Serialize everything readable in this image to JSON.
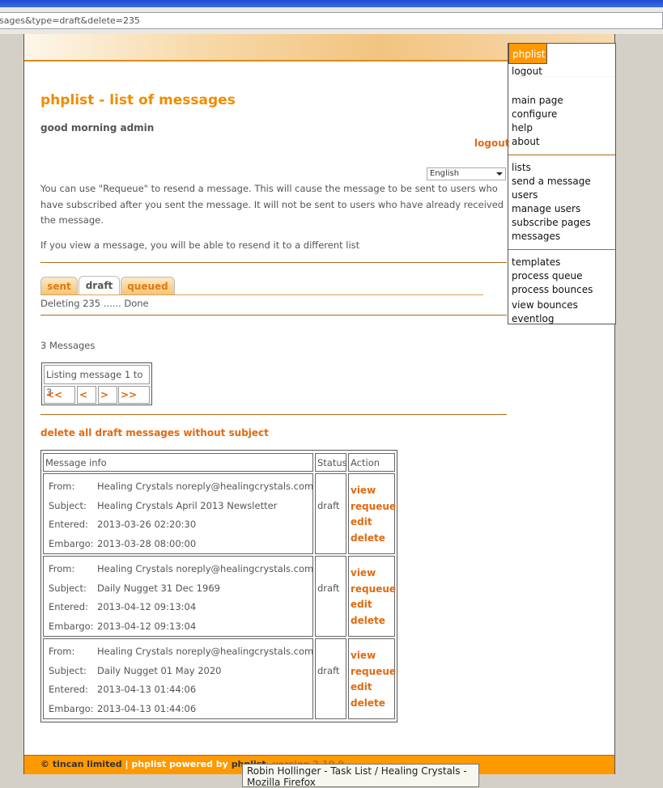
{
  "browser": {
    "url": "sages&type=draft&delete=235"
  },
  "menu": {
    "brand": "phplist",
    "logout": "logout",
    "group1": [
      "main page",
      "configure",
      "help",
      "about"
    ],
    "group2": [
      "lists",
      "send a message",
      "users",
      "manage users",
      "subscribe pages",
      "messages"
    ],
    "group3": [
      "templates",
      "process queue",
      "process bounces",
      "view bounces",
      "eventlog"
    ]
  },
  "page": {
    "title": "phplist - list of messages",
    "greeting": "good morning admin",
    "logout": "logout",
    "language": "English",
    "info1": "You can use \"Requeue\" to resend a message. This will cause the message to be sent to users who have subscribed after you sent the message. It will not be sent to users who have already received the message.",
    "info2": "If you view a message, you will be able to resend it to a different list",
    "tabs": [
      "sent",
      "draft",
      "queued"
    ],
    "status": "Deleting 235 ...... Done",
    "count": "3 Messages",
    "pager": {
      "caption": "Listing message 1 to 3",
      "first": "<<",
      "prev": "<",
      "next": ">",
      "last": ">>"
    },
    "delete_all": "delete all draft messages without subject"
  },
  "table": {
    "headers": [
      "Message info",
      "Status",
      "Action"
    ],
    "labels": [
      "From:",
      "Subject:",
      "Entered:",
      "Embargo:"
    ],
    "actions": [
      "view",
      "requeue",
      "edit",
      "delete"
    ],
    "rows": [
      {
        "from": "Healing Crystals noreply@healingcrystals.com",
        "subject": "Healing Crystals April 2013 Newsletter",
        "entered": "2013-03-26 02:20:30",
        "embargo": "2013-03-28 08:00:00",
        "status": "draft"
      },
      {
        "from": "Healing Crystals noreply@healingcrystals.com",
        "subject": "Daily Nugget 31 Dec 1969",
        "entered": "2013-04-12 09:13:04",
        "embargo": "2013-04-12 09:13:04",
        "status": "draft"
      },
      {
        "from": "Healing Crystals noreply@healingcrystals.com",
        "subject": "Daily Nugget 01 May 2020",
        "entered": "2013-04-13 01:44:06",
        "embargo": "2013-04-13 01:44:06",
        "status": "draft"
      }
    ]
  },
  "footer": {
    "copyright": "© tincan limited",
    "sep": "|",
    "powered": "phplist powered by",
    "brand": "phplist",
    "version": ", version 2.10.9"
  },
  "tooltip": "Robin Hollinger - Task List / Healing Crystals - Mozilla Firefox"
}
